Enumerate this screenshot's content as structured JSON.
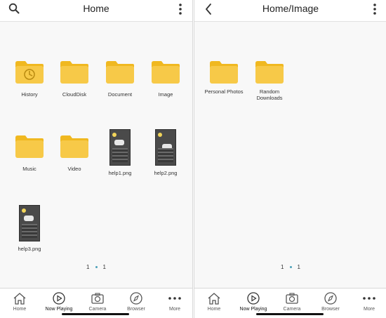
{
  "colors": {
    "folder": "#f4c430",
    "folder_tab": "#f0b820",
    "background": "#f8f8f8",
    "header_bg": "#ffffff",
    "pager_dot": "#4aa0b8"
  },
  "left": {
    "header": {
      "title": "Home",
      "left_icon": "search-icon",
      "right_icon": "more-vertical-icon"
    },
    "items": [
      {
        "label": "History",
        "type": "folder",
        "icon": "clock-icon"
      },
      {
        "label": "CloudDisk",
        "type": "folder"
      },
      {
        "label": "Document",
        "type": "folder"
      },
      {
        "label": "Image",
        "type": "folder"
      },
      {
        "label": "Music",
        "type": "folder"
      },
      {
        "label": "Video",
        "type": "folder"
      },
      {
        "label": "help1.png",
        "type": "image"
      },
      {
        "label": "help2.png",
        "type": "image"
      },
      {
        "label": "help3.png",
        "type": "image"
      }
    ],
    "pager": {
      "current": "1",
      "total": "1"
    }
  },
  "right": {
    "header": {
      "title": "Home/Image",
      "left_icon": "back-chevron-icon",
      "right_icon": "more-vertical-icon"
    },
    "items": [
      {
        "label": "Personal Photos",
        "type": "folder"
      },
      {
        "label": "Random Downloads",
        "type": "folder"
      }
    ],
    "pager": {
      "current": "1",
      "total": "1"
    }
  },
  "tabbar": {
    "tabs": [
      {
        "label": "Home",
        "icon": "house-icon"
      },
      {
        "label": "Now Playing",
        "icon": "play-circle-icon",
        "active": true
      },
      {
        "label": "Camera",
        "icon": "camera-icon"
      },
      {
        "label": "Browser",
        "icon": "compass-icon"
      },
      {
        "label": "More",
        "icon": "ellipsis-icon"
      }
    ]
  }
}
